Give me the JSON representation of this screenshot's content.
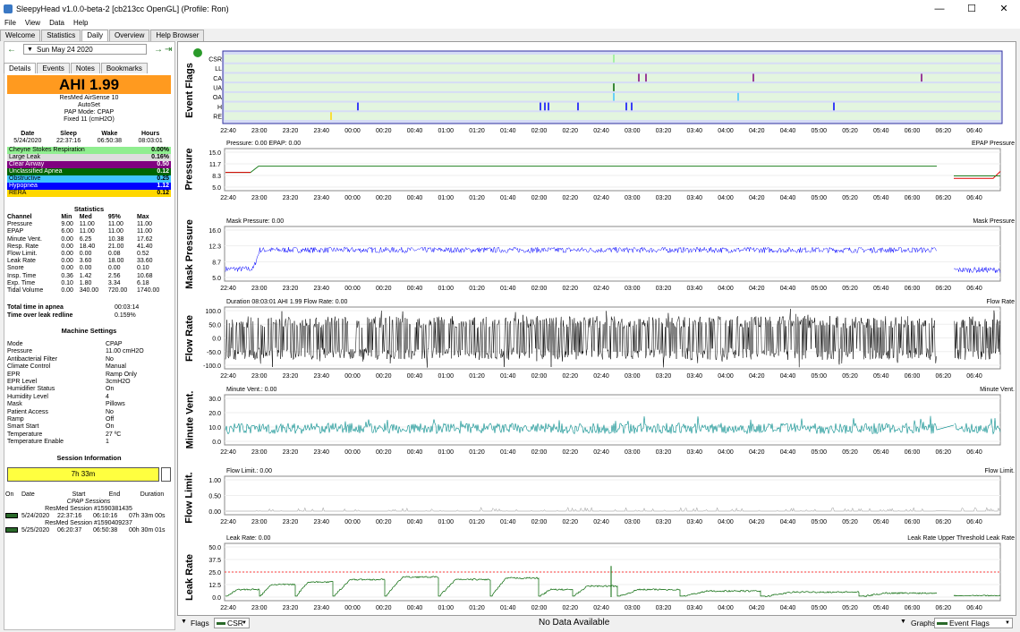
{
  "window": {
    "title": "SleepyHead v1.0.0-beta-2 [cb213cc OpenGL] (Profile: Ron)"
  },
  "menu": [
    "File",
    "View",
    "Data",
    "Help"
  ],
  "tabs": [
    "Welcome",
    "Statistics",
    "Daily",
    "Overview",
    "Help Browser"
  ],
  "date": {
    "value": "Sun May 24 2020"
  },
  "subtabs": [
    "Details",
    "Events",
    "Notes",
    "Bookmarks"
  ],
  "ahi": "AHI 1.99",
  "device": {
    "name": "ResMed AirSense 10",
    "model": "AutoSet",
    "mode": "PAP Mode: CPAP",
    "pressure": "Fixed 11 (cmH2O)"
  },
  "summary": {
    "headers": [
      "Date",
      "Sleep",
      "Wake",
      "Hours"
    ],
    "values": [
      "5/24/2020",
      "22:37:16",
      "06:50:38",
      "08:03:01"
    ]
  },
  "events": [
    {
      "name": "Cheyne Stokes Respiration",
      "value": "0.00%",
      "bg": "#90ee90",
      "fg": "#000000"
    },
    {
      "name": "Large Leak",
      "value": "0.16%",
      "bg": "#dddddd",
      "fg": "#000000"
    },
    {
      "name": "Clear Airway",
      "value": "0.50",
      "bg": "#800080",
      "fg": "#ffffff"
    },
    {
      "name": "Unclassified Apnea",
      "value": "0.12",
      "bg": "#006400",
      "fg": "#ffffff"
    },
    {
      "name": "Obstructive",
      "value": "0.25",
      "bg": "#40c4ff",
      "fg": "#000000"
    },
    {
      "name": "Hypopnea",
      "value": "1.12",
      "bg": "#0000ff",
      "fg": "#ffffff"
    },
    {
      "name": "RERA",
      "value": "0.12",
      "bg": "#ffd700",
      "fg": "#000000"
    }
  ],
  "statistics": {
    "title": "Statistics",
    "headers": [
      "Channel",
      "Min",
      "Med",
      "95%",
      "Max"
    ],
    "rows": [
      [
        "Pressure",
        "9.00",
        "11.00",
        "11.00",
        "11.00"
      ],
      [
        "EPAP",
        "6.00",
        "11.00",
        "11.00",
        "11.00"
      ],
      [
        "Minute Vent.",
        "0.00",
        "6.25",
        "10.38",
        "17.62"
      ],
      [
        "Resp. Rate",
        "0.00",
        "18.40",
        "21.00",
        "41.40"
      ],
      [
        "Flow Limit.",
        "0.00",
        "0.00",
        "0.08",
        "0.52"
      ],
      [
        "Leak Rate",
        "0.00",
        "3.60",
        "18.00",
        "33.60"
      ],
      [
        "Snore",
        "0.00",
        "0.00",
        "0.00",
        "0.10"
      ],
      [
        "Insp. Time",
        "0.36",
        "1.42",
        "2.56",
        "10.68"
      ],
      [
        "Exp. Time",
        "0.10",
        "1.80",
        "3.34",
        "6.18"
      ],
      [
        "Tidal Volume",
        "0.00",
        "340.00",
        "720.00",
        "1740.00"
      ]
    ]
  },
  "totals": [
    {
      "label": "Total time in apnea",
      "value": "00:03:14"
    },
    {
      "label": "Time over leak redline",
      "value": "0.159%"
    }
  ],
  "machine": {
    "title": "Machine Settings",
    "rows": [
      [
        "Mode",
        "CPAP"
      ],
      [
        "Pressure",
        "11.00 cmH2O"
      ],
      [
        "Antibacterial Filter",
        "No"
      ],
      [
        "Climate Control",
        "Manual"
      ],
      [
        "EPR",
        "Ramp Only"
      ],
      [
        "EPR Level",
        "3cmH2O"
      ],
      [
        "Humidifier Status",
        "On"
      ],
      [
        "Humidity Level",
        "4"
      ],
      [
        "Mask",
        "Pillows"
      ],
      [
        "Patient Access",
        "No"
      ],
      [
        "Ramp",
        "Off"
      ],
      [
        "Smart Start",
        "On"
      ],
      [
        "Temperature",
        "27 ºC"
      ],
      [
        "Temperature Enable",
        "1"
      ]
    ]
  },
  "session": {
    "title": "Session Information",
    "bar": "7h 33m",
    "headers": [
      "On",
      "Date",
      "Start",
      "End",
      "Duration"
    ],
    "group": "CPAP Sessions",
    "items": [
      {
        "name": "ResMed Session #1590381435",
        "date": "5/24/2020",
        "start": "22:37:16",
        "end": "06:10:16",
        "duration": "07h 33m 00s"
      },
      {
        "name": "ResMed Session #1590409237",
        "date": "5/25/2020",
        "start": "06:20:37",
        "end": "06:50:38",
        "duration": "00h 30m 01s"
      }
    ]
  },
  "graphs": [
    {
      "id": "flags",
      "ylabel": "Event Flags",
      "header": "",
      "legend": ""
    },
    {
      "id": "pressure",
      "ylabel": "Pressure",
      "header": "Pressure: 0.00 EPAP: 0.00",
      "legend": "EPAP  Pressure"
    },
    {
      "id": "mask",
      "ylabel": "Mask Pressure",
      "header": "Mask Pressure: 0.00",
      "legend": "Mask Pressure"
    },
    {
      "id": "flow",
      "ylabel": "Flow Rate",
      "header": "Duration 08:03:01 AHI 1.99 Flow Rate: 0.00",
      "legend": "Flow Rate"
    },
    {
      "id": "mv",
      "ylabel": "Minute Vent.",
      "header": "Minute Vent.: 0.00",
      "legend": "Minute Vent."
    },
    {
      "id": "fl",
      "ylabel": "Flow Limit.",
      "header": "Flow Limit.: 0.00",
      "legend": "Flow Limit."
    },
    {
      "id": "leak",
      "ylabel": "Leak Rate",
      "header": "Leak Rate: 0.00",
      "legend": "Leak Rate Upper Threshold  Leak Rate"
    }
  ],
  "flags_channels": [
    "CSR",
    "LL",
    "CA",
    "UA",
    "OA",
    "H",
    "RE"
  ],
  "time_ticks": [
    "22:40",
    "23:00",
    "23:20",
    "23:40",
    "00:00",
    "00:20",
    "00:40",
    "01:00",
    "01:20",
    "01:40",
    "02:00",
    "02:20",
    "02:40",
    "03:00",
    "03:20",
    "03:40",
    "04:00",
    "04:20",
    "04:40",
    "05:00",
    "05:20",
    "05:40",
    "06:00",
    "06:20",
    "06:40"
  ],
  "y_ticks": {
    "pressure": [
      "15.0",
      "11.7",
      "8.3",
      "5.0"
    ],
    "mask": [
      "16.0",
      "12.3",
      "8.7",
      "5.0"
    ],
    "flow": [
      "100.0",
      "50.0",
      "0.0",
      "-50.0",
      "-100.0"
    ],
    "mv": [
      "30.0",
      "20.0",
      "10.0",
      "0.0"
    ],
    "fl": [
      "1.00",
      "0.50",
      "0.00"
    ],
    "leak": [
      "50.0",
      "37.5",
      "25.0",
      "12.5",
      "0.0"
    ]
  },
  "bottom": {
    "flags_label": "Flags",
    "flags_select": "CSR",
    "center": "No Data Available",
    "graphs_label": "Graphs",
    "graphs_select": "Event Flags"
  },
  "colors": {
    "ahi": "#ff9a1f",
    "pressure_line": "#208020",
    "epap_line": "#e00000",
    "mask_line": "#0000ff",
    "mv_line": "#008b8b",
    "leak_line": "#006400",
    "threshold": "#ff0000",
    "flags_row": "#e3f5df",
    "flags_bg": "#d6dcf6"
  }
}
